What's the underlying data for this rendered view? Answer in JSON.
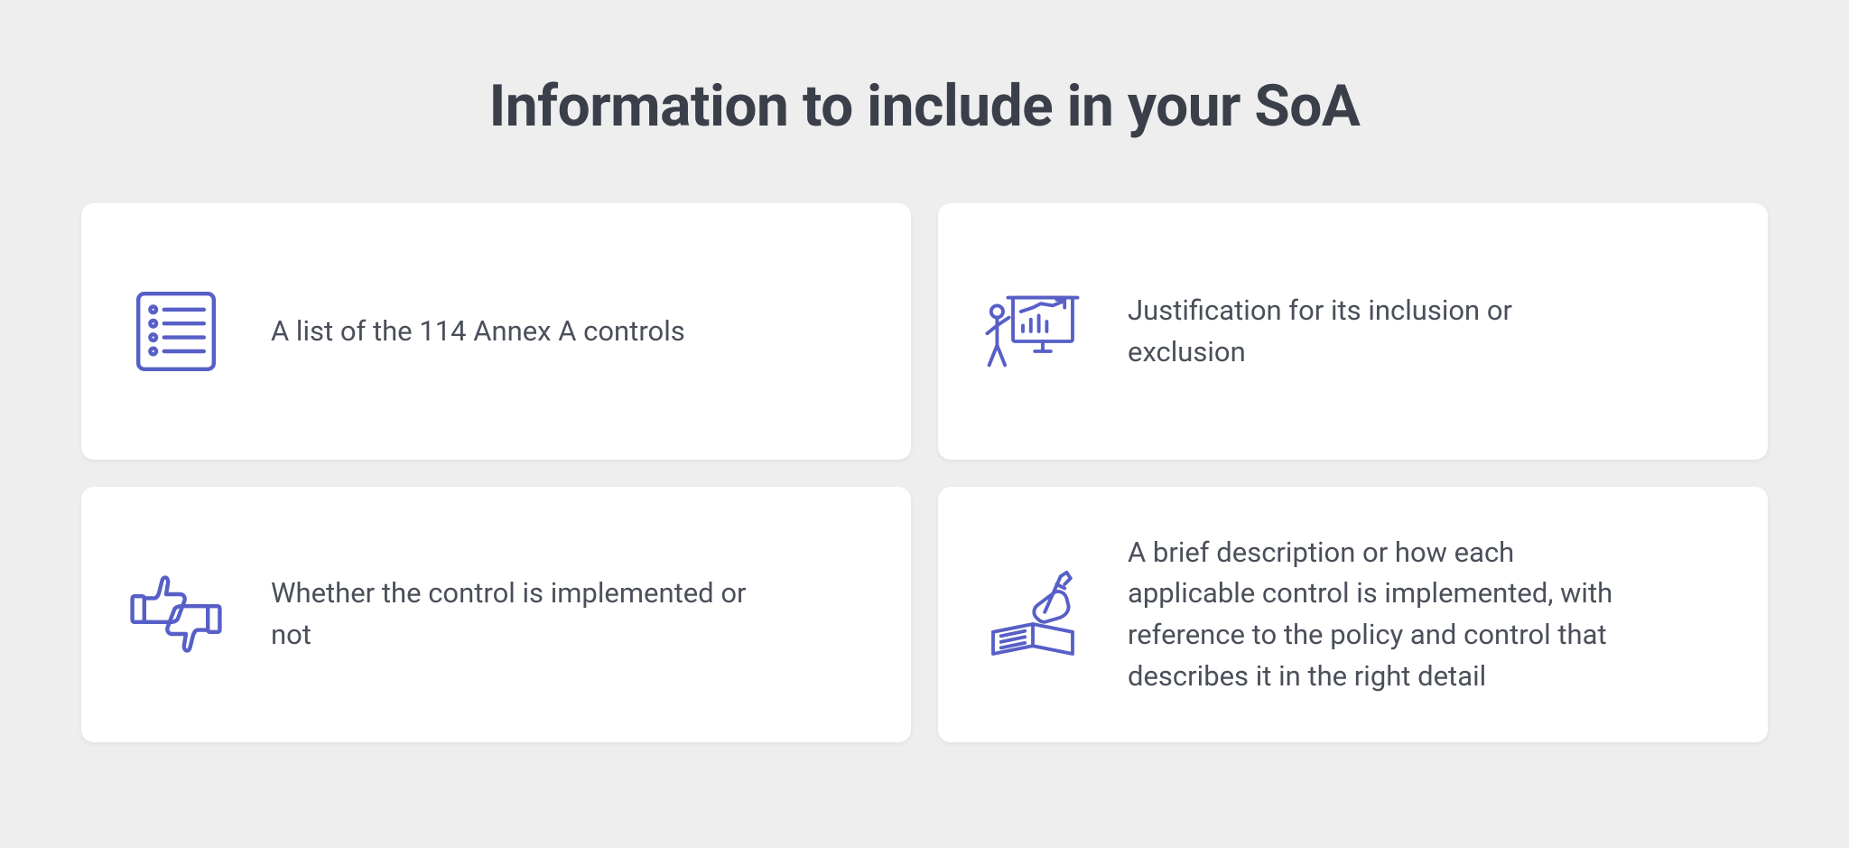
{
  "title": "Information to include in your SoA",
  "cards": [
    {
      "icon": "checklist-icon",
      "text": "A list of the 114 Annex A controls"
    },
    {
      "icon": "presentation-icon",
      "text": "Justification for its inclusion or exclusion"
    },
    {
      "icon": "thumbs-icon",
      "text": "Whether the control is implemented or not"
    },
    {
      "icon": "writing-icon",
      "text": "A brief description or how each applicable control is implemented, with reference to the policy and control that describes it in the right detail"
    }
  ],
  "colors": {
    "iconStroke": "#575FC7"
  }
}
